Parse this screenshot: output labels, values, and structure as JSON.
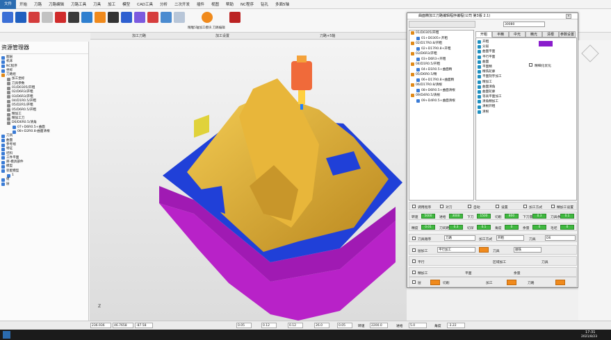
{
  "menu": [
    "文件",
    "开始",
    "刀路",
    "刀路编辑",
    "刀路工具",
    "刀具",
    "加工",
    "模型",
    "CAD工具",
    "分析",
    "二次开发",
    "插件",
    "视图",
    "帮助",
    "NC程序",
    "钻孔",
    "多面5轴"
  ],
  "toolbar_caption": "精雕5轴加工模块 刀路编辑",
  "tabs": [
    "加工刀路",
    "加工设置",
    "刀路+5轴"
  ],
  "left_panel": {
    "title": "资源管理器",
    "tree": [
      {
        "label": "图层",
        "color": "#3a7bd5",
        "indent": 0
      },
      {
        "label": "机床",
        "color": "#3a7bd5",
        "indent": 0
      },
      {
        "label": "NC程序",
        "color": "#3a7bd5",
        "indent": 0
      },
      {
        "label": "坐标",
        "color": "#3a7bd5",
        "indent": 0
      },
      {
        "label": "刀路组",
        "color": "#e08a1a",
        "indent": 0
      },
      {
        "label": "加工坐标",
        "color": "#888",
        "indent": 1
      },
      {
        "label": "刀具参数",
        "color": "#888",
        "indent": 1
      },
      {
        "label": "01/D0305/开粗",
        "color": "#888",
        "indent": 1
      },
      {
        "label": "02/D6R3/开粗",
        "color": "#888",
        "indent": 1
      },
      {
        "label": "03/D6R3/开粗",
        "color": "#888",
        "indent": 1
      },
      {
        "label": "04/D1R0.5/开粗",
        "color": "#888",
        "indent": 1
      },
      {
        "label": "05/D2R1/开粗",
        "color": "#888",
        "indent": 1
      },
      {
        "label": "05/D6R0.5/开粗",
        "color": "#888",
        "indent": 1
      },
      {
        "label": "精加工",
        "color": "#888",
        "indent": 1
      },
      {
        "label": "精加工刀",
        "color": "#888",
        "indent": 1
      },
      {
        "label": "D6/D6R0.5/清角",
        "color": "#888",
        "indent": 1
      },
      {
        "label": "07+D6R0.5+曲面",
        "color": "#3a7bd5",
        "indent": 2
      },
      {
        "label": "08+D2R0.8-曲面清根",
        "color": "#3a7bd5",
        "indent": 2
      },
      {
        "label": "刀具",
        "color": "#3a7bd5",
        "indent": 0
      },
      {
        "label": "曲面",
        "color": "#3a7bd5",
        "indent": 0
      },
      {
        "label": "参考线",
        "color": "#3a7bd5",
        "indent": 0
      },
      {
        "label": "特征",
        "color": "#3a7bd5",
        "indent": 0
      },
      {
        "label": "坯料",
        "color": "#3a7bd5",
        "indent": 0
      },
      {
        "label": "工件平面",
        "color": "#3a7bd5",
        "indent": 0
      },
      {
        "label": "库-模具部件",
        "color": "#3a7bd5",
        "indent": 0
      },
      {
        "label": "模型",
        "color": "#3a7bd5",
        "indent": 0
      },
      {
        "label": "装配模型",
        "color": "#3a7bd5",
        "indent": 0
      },
      {
        "label": "1",
        "color": "#3a7bd5",
        "indent": 1
      },
      {
        "label": "组",
        "color": "#3a7bd5",
        "indent": 0
      },
      {
        "label": "层",
        "color": "#3a7bd5",
        "indent": 0
      }
    ]
  },
  "dialog": {
    "title": "曲面精加工刀路编辑程序编程(公司 第3版 2.1)",
    "input_value": "30080",
    "list": [
      {
        "label": "01/D0305/开粗",
        "color": "#e08a1a"
      },
      {
        "label": "01+D0305+开粗",
        "color": "#3a7bd5"
      },
      {
        "label": "02/D17R0.8/开粗",
        "color": "#e08a1a"
      },
      {
        "label": "02+D17R0.8+开粗",
        "color": "#3a7bd5"
      },
      {
        "label": "03/D6R3/开粗",
        "color": "#e08a1a"
      },
      {
        "label": "03+D6R3+开粗",
        "color": "#3a7bd5"
      },
      {
        "label": "04/D1R0.5/开粗",
        "color": "#e08a1a"
      },
      {
        "label": "04+D1R0.5+曲面精",
        "color": "#3a7bd5"
      },
      {
        "label": "05/D6R0.5/精",
        "color": "#e08a1a"
      },
      {
        "label": "06+D17R0.8+曲面精",
        "color": "#3a7bd5"
      },
      {
        "label": "06/D17R0.8/清根",
        "color": "#e08a1a"
      },
      {
        "label": "08+D6R0.5+曲面清根",
        "color": "#3a7bd5"
      },
      {
        "label": "09/D4R0.5/清根",
        "color": "#e08a1a"
      },
      {
        "label": "09+D4R0.5+曲面清根",
        "color": "#3a7bd5"
      }
    ],
    "tabs": [
      "开粗",
      "半精",
      "中光",
      "精光",
      "清根",
      "参数设置"
    ],
    "ops": [
      "开粗",
      "分层",
      "曲面平面",
      "平行平面",
      "曲面",
      "平面精",
      "精铣轮廓",
      "平面刻字加工",
      "精加工",
      "曲面清角",
      "曲面轮廓",
      "等高平面加工",
      "清角精加工",
      "清根开粗",
      "清根"
    ],
    "side_check": "精细化优化",
    "options": [
      "调用程序",
      "对刀",
      "自动",
      "设置",
      "加工方式",
      "精加工设置"
    ],
    "row1_labels": [
      "转速",
      "进给",
      "下刀",
      "切削",
      "下刀量",
      "刀具余量"
    ],
    "row1_values": [
      "5000",
      "3000",
      "1500",
      "800",
      "0.3",
      "0.1"
    ],
    "row2_labels": [
      "精度",
      "刀间距",
      "切深",
      "角度",
      "余量",
      "毛坯"
    ],
    "row2_values": [
      "0.01",
      "0.3",
      "0.1",
      "0",
      "0",
      "0"
    ],
    "row3": {
      "a": "刀具顺序",
      "b": "刀路",
      "c": "加工方式",
      "d": "开粗",
      "e": "刀具",
      "f": "D6"
    },
    "row4": {
      "a": "层加工",
      "b": "平行加工",
      "c": "刀具",
      "d": "顺铣"
    },
    "row5": {
      "a": "平行",
      "b": "区域加工",
      "c": "刀具"
    },
    "row6": {
      "a": "精加工",
      "b": "平面",
      "c": "余量"
    },
    "row7": {
      "a": "层",
      "b": "切削",
      "c": "加工",
      "d": "刀路"
    },
    "row8": {
      "a": "方式",
      "b": "加工",
      "c": "切削",
      "d": "精度"
    }
  },
  "status": {
    "x": "236.936",
    "y": "46.7658",
    "z": "-87.58",
    "f1": "0.05",
    "f2": "0.12",
    "f3": "0.12",
    "f4": "26.0",
    "f5": "0.05",
    "speed_label": "转速",
    "speed": "2200.0",
    "feed_label": "进给",
    "feed": "5.0",
    "angle_label": "角度",
    "angle": "-3.22"
  },
  "clock": {
    "time": "17:31",
    "date": "2021/8/23"
  }
}
